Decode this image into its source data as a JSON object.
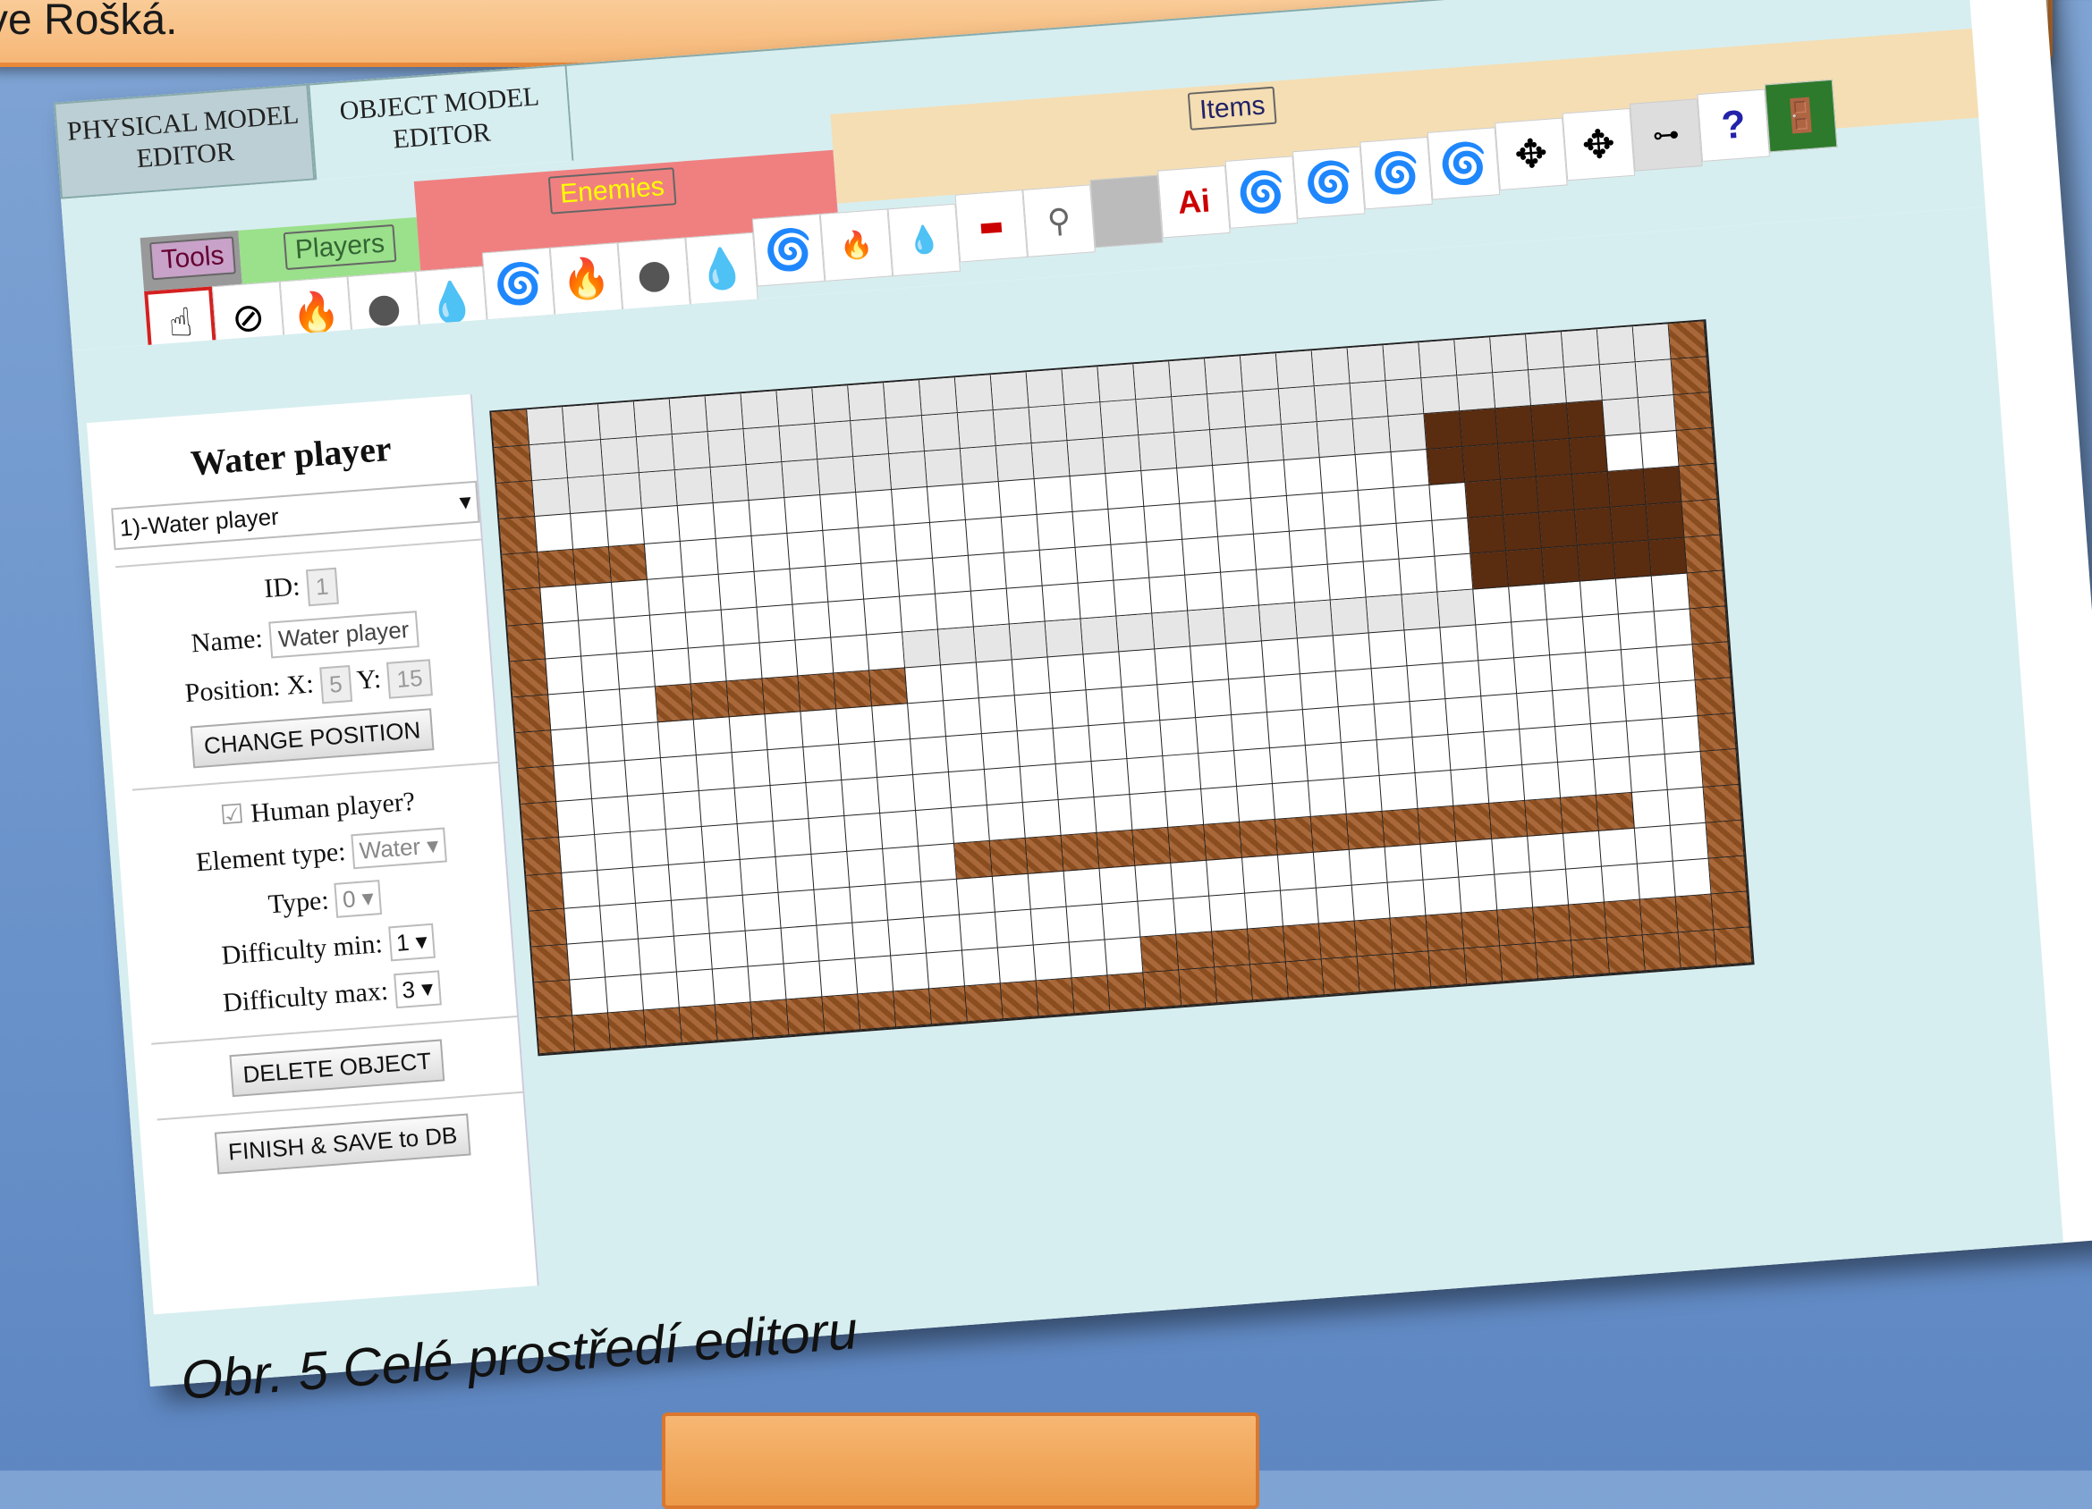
{
  "slide": {
    "banner_text": "ve Rošká."
  },
  "tabs": {
    "physical": "PHYSICAL MODEL EDITOR",
    "object": "OBJECT MODEL EDITOR"
  },
  "palette": {
    "categories": {
      "tools": "Tools",
      "players": "Players",
      "enemies": "Enemies",
      "items": "Items"
    },
    "item_label_ai": "Ai",
    "item_label_unknown": "?"
  },
  "inspector": {
    "title": "Water player",
    "object_select": "1)-Water player",
    "id_label": "ID:",
    "id_value": "1",
    "name_label": "Name:",
    "name_value": "Water player",
    "position_label": "Position: X:",
    "x_value": "5",
    "y_label": "Y:",
    "y_value": "15",
    "change_position": "CHANGE POSITION",
    "human_player_label": "Human player?",
    "element_type_label": "Element type:",
    "element_type_value": "Water",
    "type_label": "Type:",
    "type_value": "0",
    "difficulty_min_label": "Difficulty min:",
    "difficulty_min_value": "1",
    "difficulty_max_label": "Difficulty max:",
    "difficulty_max_value": "3",
    "delete_object": "DELETE OBJECT",
    "finish_save": "FINISH & SAVE to DB"
  },
  "caption": "Obr. 5 Celé prostředí editoru"
}
